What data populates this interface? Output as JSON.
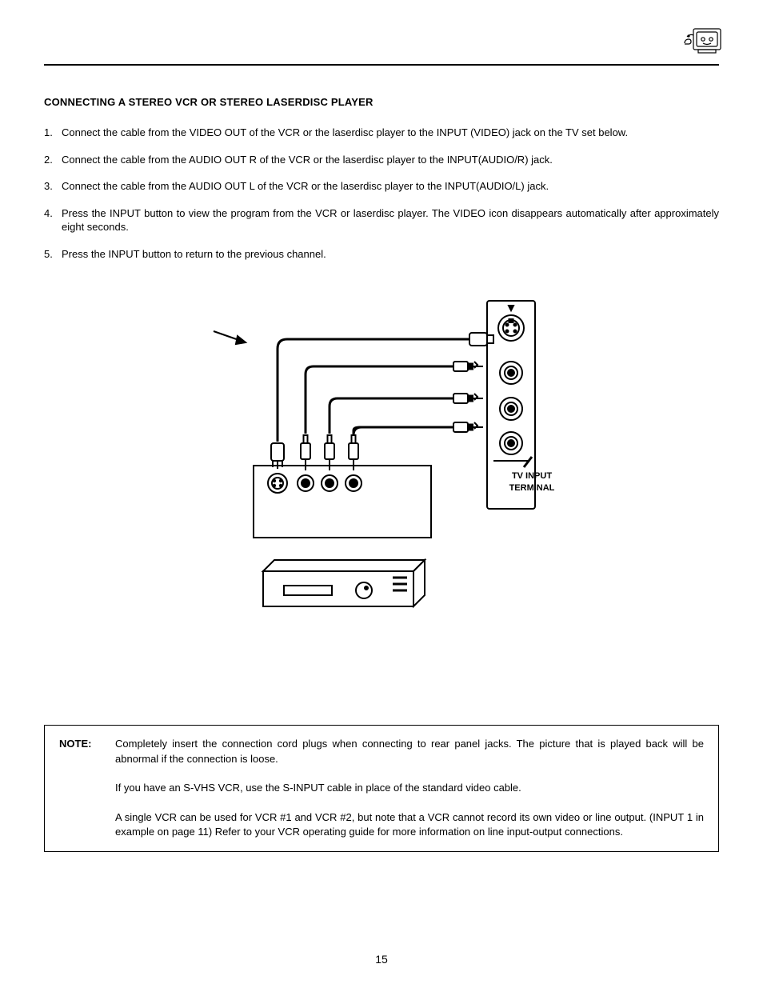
{
  "title": "CONNECTING A STEREO VCR OR STEREO LASERDISC PLAYER",
  "steps": [
    {
      "num": "1.",
      "text": "Connect the cable from the VIDEO OUT of the VCR or the laserdisc player to the INPUT (VIDEO) jack on the TV set below."
    },
    {
      "num": "2.",
      "text": "Connect the cable from the AUDIO OUT R of the VCR or the laserdisc player to the INPUT(AUDIO/R) jack."
    },
    {
      "num": "3.",
      "text": "Connect the cable from the AUDIO OUT L of the VCR or the laserdisc player to the INPUT(AUDIO/L) jack."
    },
    {
      "num": "4.",
      "text": "Press the INPUT button to view the program from the VCR or laserdisc player.  The VIDEO icon disappears automatically after approximately eight seconds."
    },
    {
      "num": "5.",
      "text": "Press the INPUT button to return to the previous channel."
    }
  ],
  "diagram": {
    "terminal_label_line1": "TV INPUT",
    "terminal_label_line2": "TERMINAL"
  },
  "note": {
    "label": "NOTE:",
    "paragraphs": [
      "Completely insert the connection cord plugs when connecting to rear panel jacks.  The picture that is played back will be abnormal if the connection is loose.",
      "If you have an S-VHS VCR, use the S-INPUT cable in place of the standard video cable.",
      "A single VCR can be used for VCR #1 and VCR #2, but note that a VCR cannot record its own video or line output. (INPUT 1 in example on page 11)  Refer to your VCR operating guide for more information on line input-output connections."
    ]
  },
  "page_number": "15"
}
